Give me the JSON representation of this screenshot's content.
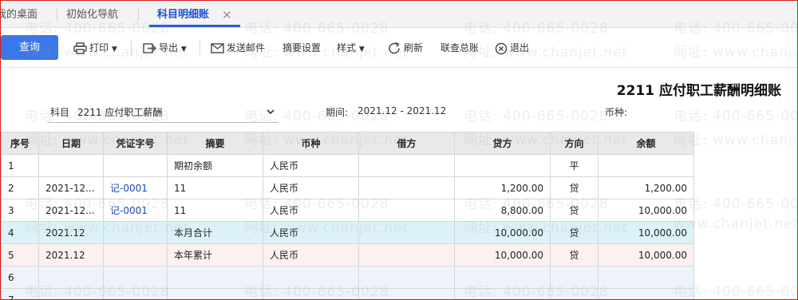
{
  "tabs": [
    {
      "label": "我的桌面"
    },
    {
      "label": "初始化导航"
    },
    {
      "label": "科目明细账"
    }
  ],
  "toolbar": {
    "query": "查询",
    "print": "打印",
    "export": "导出",
    "send_mail": "发送邮件",
    "summary_settings": "摘要设置",
    "style": "样式",
    "refresh": "刷新",
    "check_ledger": "联查总账",
    "exit": "退出"
  },
  "report": {
    "title": "2211 应付职工薪酬明细账",
    "subject_label": "科目",
    "subject_value": "2211 应付职工薪酬",
    "period_label": "期间:",
    "period_value": "2021.12 - 2021.12",
    "currency_label": "币种:"
  },
  "table": {
    "headers": [
      "序号",
      "日期",
      "凭证字号",
      "摘要",
      "币种",
      "借方",
      "贷方",
      "方向",
      "余额"
    ],
    "rows": [
      {
        "no": "1",
        "date": "",
        "voucher": "",
        "summary": "期初余额",
        "currency": "人民币",
        "debit": "",
        "credit": "",
        "direction": "平",
        "balance": ""
      },
      {
        "no": "2",
        "date": "2021-12...",
        "voucher": "记-0001",
        "summary": "11",
        "currency": "人民币",
        "debit": "",
        "credit": "1,200.00",
        "direction": "贷",
        "balance": "1,200.00"
      },
      {
        "no": "3",
        "date": "2021-12...",
        "voucher": "记-0001",
        "summary": "11",
        "currency": "人民币",
        "debit": "",
        "credit": "8,800.00",
        "direction": "贷",
        "balance": "10,000.00"
      },
      {
        "no": "4",
        "date": "2021.12",
        "voucher": "",
        "summary": "本月合计",
        "currency": "人民币",
        "debit": "",
        "credit": "10,000.00",
        "direction": "贷",
        "balance": "10,000.00"
      },
      {
        "no": "5",
        "date": "2021.12",
        "voucher": "",
        "summary": "本年累计",
        "currency": "人民币",
        "debit": "",
        "credit": "10,000.00",
        "direction": "贷",
        "balance": "10,000.00"
      },
      {
        "no": "6",
        "date": "",
        "voucher": "",
        "summary": "",
        "currency": "",
        "debit": "",
        "credit": "",
        "direction": "",
        "balance": ""
      },
      {
        "no": "7",
        "date": "",
        "voucher": "",
        "summary": "",
        "currency": "",
        "debit": "",
        "credit": "",
        "direction": "",
        "balance": ""
      }
    ]
  },
  "watermark": {
    "phone": "电话: 400-665-0028",
    "site": "网址: www.chanjet.net",
    "site_partial": "www.chanjet.net"
  },
  "colors": {
    "accent": "#3a78e8",
    "active_tab": "#1f4fd8",
    "voucher_link": "#1d47b8",
    "frame_border": "#d41c1c",
    "month_row": "#ddf2f8",
    "year_row": "#fdf0f0"
  }
}
